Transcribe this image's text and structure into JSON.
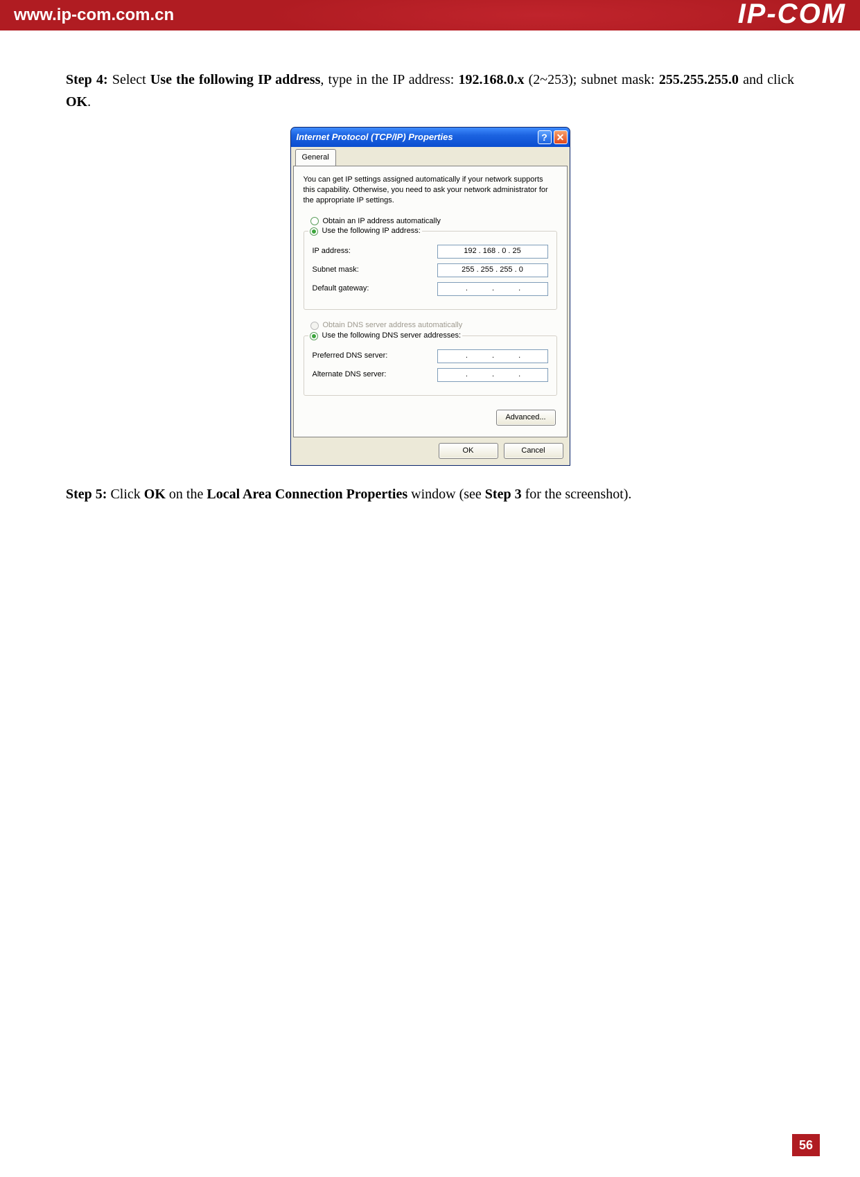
{
  "header": {
    "url": "www.ip-com.com.cn",
    "brand": "IP-COM"
  },
  "steps": {
    "s4_prefix": "Step 4:",
    "s4_a": " Select ",
    "s4_bold1": "Use the following IP address",
    "s4_b": ", type in the IP address: ",
    "s4_bold2": "192.168.0.x",
    "s4_c": " (2~253); subnet mask: ",
    "s4_bold3": "255.255.255.0",
    "s4_d": " and click ",
    "s4_bold4": "OK",
    "s4_e": ".",
    "s5_prefix": "Step 5:",
    "s5_a": " Click ",
    "s5_b1": "OK",
    "s5_b": " on the ",
    "s5_b2": "Local Area Connection Properties",
    "s5_c": " window (see ",
    "s5_b3": "Step 3",
    "s5_d": " for the screenshot)."
  },
  "dialog": {
    "title": "Internet Protocol (TCP/IP) Properties",
    "help": "?",
    "close": "✕",
    "tab_general": "General",
    "intro": "You can get IP settings assigned automatically if your network supports this capability. Otherwise, you need to ask your network administrator for the appropriate IP settings.",
    "radio_ip_auto": "Obtain an IP address automatically",
    "radio_ip_manual": "Use the following IP address:",
    "lbl_ip": "IP address:",
    "lbl_subnet": "Subnet mask:",
    "lbl_gateway": "Default gateway:",
    "val_ip": "192 . 168 .   0    . 25",
    "val_subnet": "255 . 255 . 255 .   0",
    "val_gateway_dots": ".       .       .",
    "radio_dns_auto": "Obtain DNS server address automatically",
    "radio_dns_manual": "Use the following DNS server addresses:",
    "lbl_pref_dns": "Preferred DNS server:",
    "lbl_alt_dns": "Alternate DNS server:",
    "val_dns_dots": ".       .       .",
    "btn_advanced": "Advanced...",
    "btn_ok": "OK",
    "btn_cancel": "Cancel"
  },
  "page_number": "56"
}
